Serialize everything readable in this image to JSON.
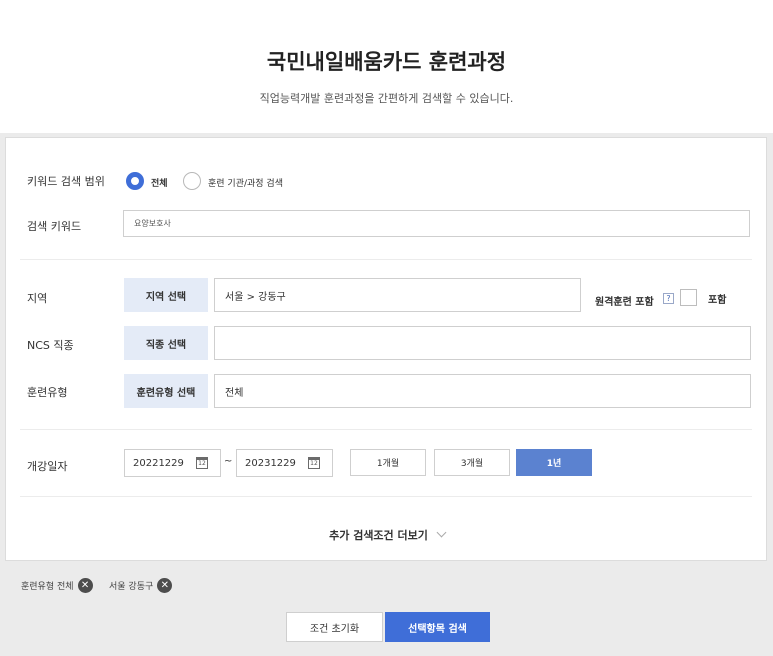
{
  "header": {
    "title": "국민내일배움카드 훈련과정",
    "subtitle": "직업능력개발 훈련과정을 간편하게 검색할 수 있습니다."
  },
  "search_scope": {
    "label": "키워드 검색 범위",
    "options": [
      {
        "label": "전체",
        "selected": true
      },
      {
        "label": "훈련 기관/과정 검색",
        "selected": false
      }
    ]
  },
  "keyword": {
    "label": "검색 키워드",
    "value": "요양보호사"
  },
  "region": {
    "label": "지역",
    "button": "지역 선택",
    "value": "서울 > 강동구",
    "remote_label": "원격훈련 포함",
    "help": "?",
    "include_label": "포함",
    "include_checked": false
  },
  "ncs": {
    "label": "NCS 직종",
    "button": "직종 선택",
    "value": ""
  },
  "training_type": {
    "label": "훈련유형",
    "button": "훈련유형 선택",
    "value": "전체"
  },
  "start_date": {
    "label": "개강일자",
    "from": "20221229",
    "to": "20231229",
    "separator": "~",
    "calendar_icon_text": "12",
    "periods": [
      {
        "label": "1개월",
        "active": false
      },
      {
        "label": "3개월",
        "active": false
      },
      {
        "label": "1년",
        "active": true
      }
    ]
  },
  "more_conditions": "추가 검색조건 더보기",
  "chips": [
    {
      "label": "훈련유형 전체"
    },
    {
      "label": "서울 강동구"
    }
  ],
  "chip_remove_glyph": "✕",
  "actions": {
    "reset": "조건 초기화",
    "search": "선택항목 검색"
  },
  "colors": {
    "accent": "#3f6ed8",
    "active_period": "#5b82d0",
    "select_button_bg": "#e4ebf7",
    "panel_bg": "#ebebeb"
  }
}
